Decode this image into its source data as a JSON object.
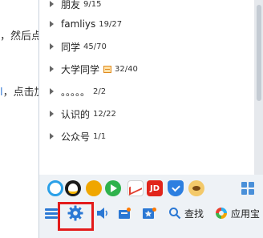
{
  "background_document": {
    "line1": "，然后点",
    "line2_prefix": "l",
    "line2_rest": "，点击加"
  },
  "contact_groups": [
    {
      "name": "朋友",
      "count": "9/15",
      "has_mail_icon": false
    },
    {
      "name": "famliys",
      "count": "19/27",
      "has_mail_icon": false
    },
    {
      "name": "同学",
      "count": "45/70",
      "has_mail_icon": false
    },
    {
      "name": "大学同学",
      "count": "32/40",
      "has_mail_icon": true
    },
    {
      "name": "。。。。。",
      "count": "2/2",
      "has_mail_icon": false
    },
    {
      "name": "认识的",
      "count": "12/22",
      "has_mail_icon": false
    },
    {
      "name": "公众号",
      "count": "1/1",
      "has_mail_icon": false
    }
  ],
  "app_bar": {
    "icons": [
      "qzone-icon",
      "qq-pet-icon",
      "wallet-icon",
      "tencent-video-icon",
      "stock-icon",
      "jd-icon",
      "qq-guard-icon",
      "pet-icon",
      "app-grid-icon"
    ],
    "jd_label": "JD"
  },
  "toolbar": {
    "menu_icon": "hamburger-menu-icon",
    "settings_icon": "gear-icon",
    "speaker_icon": "speaker-icon",
    "message_box_icon": "message-box-icon",
    "favorites_icon": "favorites-icon",
    "search_label": "查找",
    "appstore_label": "应用宝"
  },
  "colors": {
    "accent_blue": "#2b78d4",
    "highlight_red": "#e31b1b",
    "panel_bg": "#eef2f6"
  }
}
